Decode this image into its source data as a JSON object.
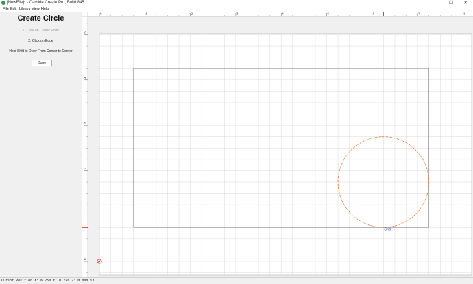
{
  "window": {
    "title": "[NewFile]* - Carbide Create Pro, Build 845",
    "app_icon": "carbide-create-icon",
    "controls": {
      "minimize": "–",
      "maximize": "☐",
      "close": "✕"
    }
  },
  "menu": [
    "File",
    "Edit",
    "Library",
    "View",
    "Help"
  ],
  "panel": {
    "title": "Create Circle",
    "step1": "1. Click on Center Point",
    "step2": "2. Click on Edge",
    "hint": "Hold Shift to Draw From Corner to Corner",
    "done_label": "Done"
  },
  "canvas": {
    "units": "in",
    "x_range": [
      0,
      8
    ],
    "y_range": [
      0,
      5
    ],
    "grid_step": 0.25,
    "ruler_x_labels": [
      "0",
      "1",
      "2",
      "3",
      "4",
      "5",
      "6",
      "7",
      "8"
    ],
    "ruler_y_labels": [
      "0",
      "1",
      "2",
      "3",
      "4",
      "5"
    ],
    "stock_rect": {
      "x0": 0.75,
      "y0": 0.75,
      "x1": 7.25,
      "y1": 4.25
    },
    "circle": {
      "cx": 6.25,
      "cy": 1.75,
      "r": 1.0
    },
    "snap_label": "Grid",
    "snap_point": {
      "x": 6.25,
      "y": 0.75
    },
    "cursor": {
      "x": 6.25,
      "y": 0.75
    },
    "colors": {
      "grid": "#d9d9d9",
      "stock": "#8c8c8c",
      "circle": "#e07b3a",
      "marker": "#e53935",
      "snap": "#2233aa"
    }
  },
  "status": {
    "text": "Cursor Position X: 6.250 Y: 0.750 Z: 0.000 in"
  }
}
